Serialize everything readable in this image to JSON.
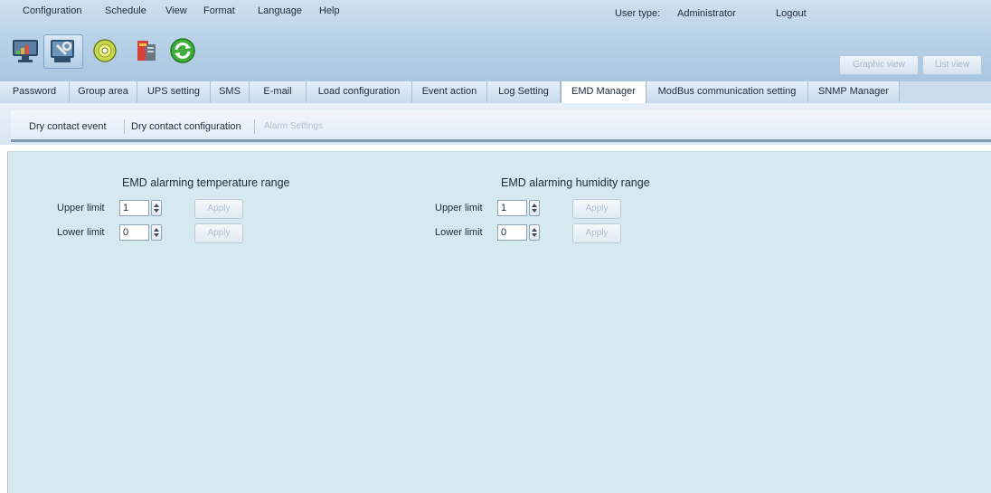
{
  "menu": {
    "items": [
      "Configuration",
      "Schedule",
      "View",
      "Format",
      "Language",
      "Help"
    ],
    "user_type_label": "User type:",
    "user_type_value": "Administrator",
    "logout": "Logout"
  },
  "toolbar": {
    "icons": [
      "monitor-icon",
      "settings-tools-icon",
      "disc-icon",
      "ups-battery-icon",
      "refresh-icon"
    ],
    "graphic_view": "Graphic view",
    "list_view": "List view"
  },
  "tabs": {
    "items": [
      "Password",
      "Group area",
      "UPS setting",
      "SMS",
      "E-mail",
      "Load configuration",
      "Event action",
      "Log Setting",
      "EMD Manager",
      "ModBus communication setting",
      "SNMP Manager"
    ],
    "active": "EMD Manager"
  },
  "subtabs": {
    "items": [
      "Dry contact event",
      "Dry contact configuration",
      "Alarm Settings"
    ],
    "disabled": [
      "Alarm Settings"
    ]
  },
  "temperature": {
    "title": "EMD alarming temperature range",
    "upper_label": "Upper limit",
    "upper_value": "1",
    "lower_label": "Lower limit",
    "lower_value": "0",
    "apply": "Apply"
  },
  "humidity": {
    "title": "EMD alarming humidity range",
    "upper_label": "Upper limit",
    "upper_value": "1",
    "lower_label": "Lower limit",
    "lower_value": "0",
    "apply": "Apply"
  },
  "colors": {
    "header_bg": "#b9d2e8",
    "content_bg": "#d6e9f1",
    "disabled_text": "#b1bfcc"
  }
}
